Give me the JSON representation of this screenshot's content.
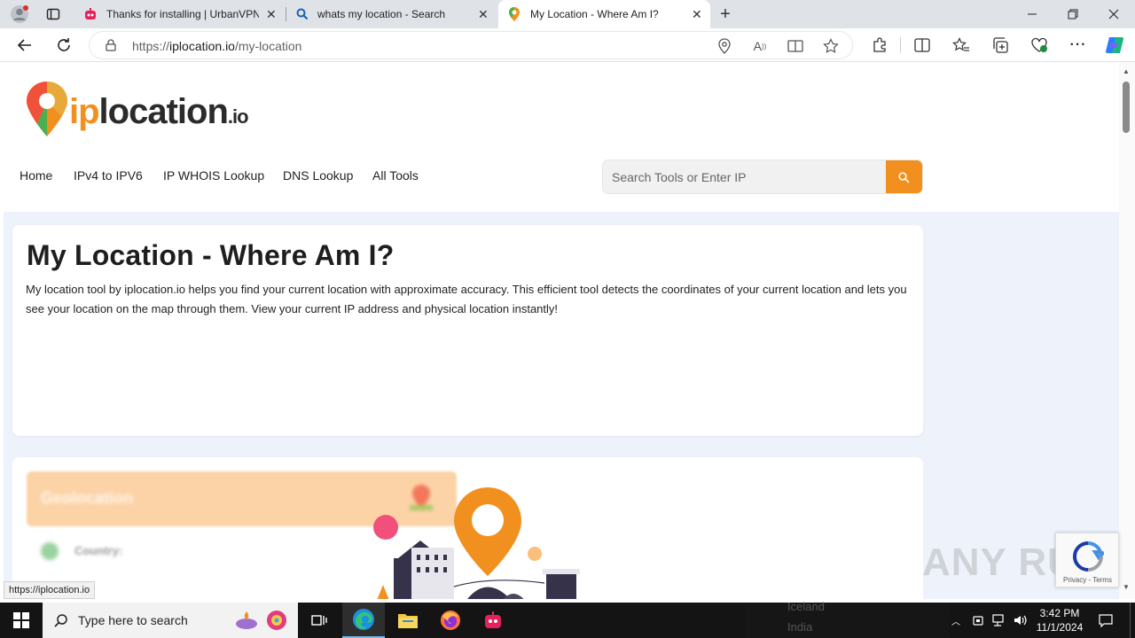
{
  "browser": {
    "tabs": [
      {
        "title": "Thanks for installing | UrbanVPN",
        "active": false
      },
      {
        "title": "whats my location - Search",
        "active": false
      },
      {
        "title": "My Location - Where Am I?",
        "active": true
      }
    ],
    "url_scheme": "https://",
    "url_host": "iplocation.io",
    "url_path": "/my-location",
    "status_url": "https://iplocation.io"
  },
  "site": {
    "logo_ip": "ip",
    "logo_location": "location",
    "logo_tld": ".io",
    "nav": [
      "Home",
      "IPv4 to IPV6",
      "IP WHOIS Lookup",
      "DNS Lookup",
      "All Tools"
    ],
    "search_placeholder": "Search Tools or Enter IP",
    "brand_color": "#f2901f"
  },
  "main": {
    "title": "My Location - Where Am I?",
    "description": "My location tool by iplocation.io helps you find your current location with approximate accuracy. This efficient tool detects the coordinates of your current location and lets you see your location on the map through them. View your current IP address and physical location instantly!",
    "geo_heading": "Geolocation",
    "geo_country_label": "Country:"
  },
  "recaptcha": {
    "links": "Privacy - Terms"
  },
  "watermark": "ANY RUN",
  "taskbar": {
    "search_placeholder": "Type here to search",
    "time": "3:42 PM",
    "date": "11/1/2024",
    "bg_items": [
      "Iceland",
      "India"
    ]
  }
}
